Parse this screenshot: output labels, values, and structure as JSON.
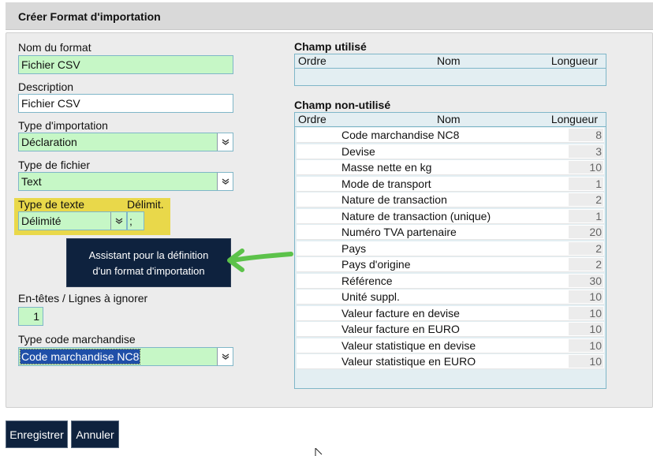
{
  "title": "Créer Format d'importation",
  "form": {
    "format_name_label": "Nom du format",
    "format_name_value": "Fichier CSV",
    "description_label": "Description",
    "description_value": "Fichier CSV",
    "import_type_label": "Type d'importation",
    "import_type_value": "Déclaration",
    "file_type_label": "Type de fichier",
    "file_type_value": "Text",
    "text_type_label": "Type de texte",
    "text_type_value": "Délimité",
    "delimiter_label": "Délimit.",
    "delimiter_value": ";",
    "headers_label": "En-têtes / Lignes à ignorer",
    "headers_value": "1",
    "commodity_type_label": "Type code marchandise",
    "commodity_type_value": "Code marchandise NC8"
  },
  "tooltip": {
    "line1": "Assistant pour la définition",
    "line2": "d'un format d'importation"
  },
  "used_fields": {
    "title": "Champ utilisé",
    "columns": [
      "Ordre",
      "Nom",
      "Longueur"
    ]
  },
  "unused_fields": {
    "title": "Champ non-utilisé",
    "columns": [
      "Ordre",
      "Nom",
      "Longueur"
    ],
    "rows": [
      {
        "name": "Code marchandise NC8",
        "length": "8"
      },
      {
        "name": "Devise",
        "length": "3"
      },
      {
        "name": "Masse nette en kg",
        "length": "10"
      },
      {
        "name": "Mode de transport",
        "length": "1"
      },
      {
        "name": "Nature de transaction",
        "length": "2"
      },
      {
        "name": "Nature de transaction (unique)",
        "length": "1"
      },
      {
        "name": "Numéro TVA partenaire",
        "length": "20"
      },
      {
        "name": "Pays",
        "length": "2"
      },
      {
        "name": "Pays d'origine",
        "length": "2"
      },
      {
        "name": "Référence",
        "length": "30"
      },
      {
        "name": "Unité suppl.",
        "length": "10"
      },
      {
        "name": "Valeur facture en devise",
        "length": "10"
      },
      {
        "name": "Valeur facture en EURO",
        "length": "10"
      },
      {
        "name": "Valeur statistique en devise",
        "length": "10"
      },
      {
        "name": "Valeur statistique en EURO",
        "length": "10"
      }
    ]
  },
  "buttons": {
    "save": "Enregistrer",
    "cancel": "Annuler"
  },
  "colors": {
    "highlight_yellow": "#e9d84a",
    "field_green": "#c6f7c6",
    "tooltip_navy": "#0e223e",
    "arrow_green": "#5cc24a"
  }
}
